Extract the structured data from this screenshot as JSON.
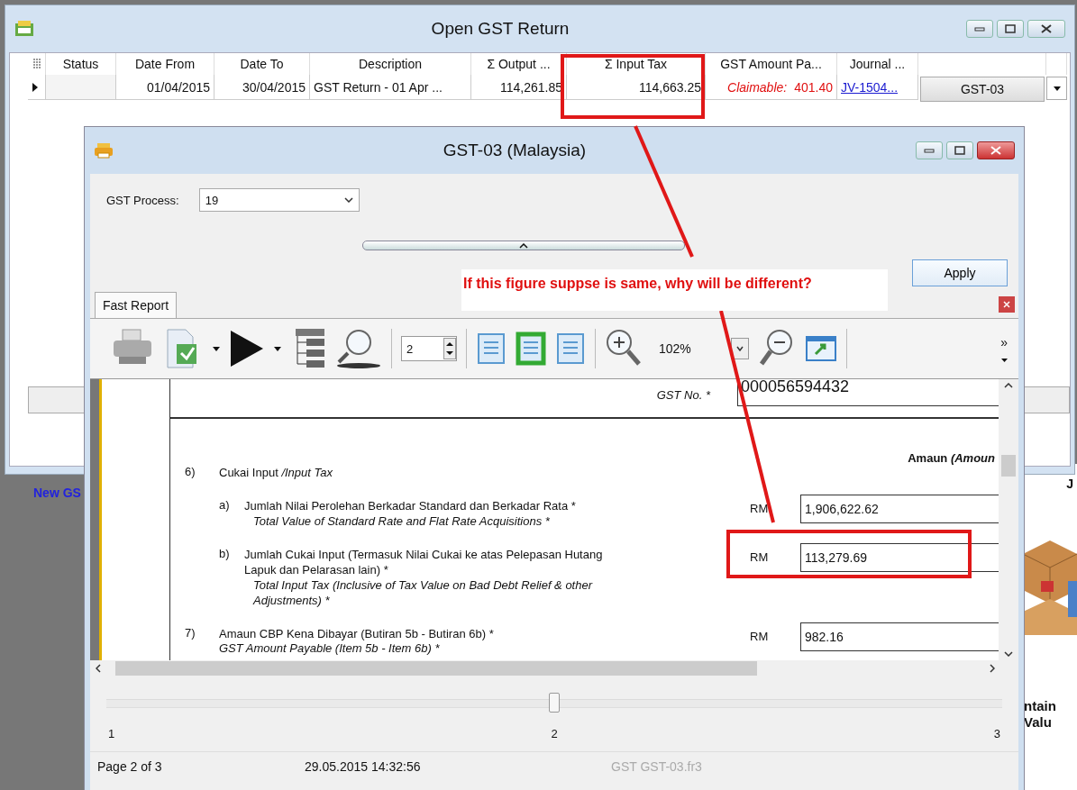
{
  "main_window": {
    "title": "Open GST Return",
    "columns": [
      "Status",
      "Date From",
      "Date To",
      "Description",
      "Σ Output ...",
      "Σ Input Tax",
      "GST Amount Pa...",
      "Journal ..."
    ],
    "rows": [
      {
        "selected": true,
        "status": "",
        "date_from": "01/04/2015",
        "date_to": "30/04/2015",
        "description": "GST Return - 01 Apr ...",
        "output_tax": "114,261.85",
        "input_tax": "114,663.25",
        "amount_label": "Claimable:",
        "amount": "401.40",
        "journal": "JV-1504...",
        "form": "GST-03"
      }
    ],
    "link": "New GS"
  },
  "report_window": {
    "title": "GST-03 (Malaysia)",
    "process_label": "GST Process:",
    "process_value": "19",
    "apply": "Apply",
    "tab": "Fast Report",
    "page_field": "2",
    "zoom_field": "102%",
    "overflow": "»",
    "report": {
      "gst_no_label": "GST No. *",
      "gst_no": "000056594432",
      "amount_heading": "Amaun *(Amoun*",
      "sections": [
        {
          "number": "6)",
          "text": "Cukai Input */Input Tax*",
          "subitems": [
            {
              "letter": "a)",
              "malay": "Jumlah Nilai Perolehan Berkadar Standard dan Berkadar Rata *",
              "english": "Total Value of Standard Rate and Flat Rate Acquisitions *",
              "currency": "RM",
              "value": "1,906,622.62"
            },
            {
              "letter": "b)",
              "malay": "Jumlah Cukai Input (Termasuk Nilai Cukai ke atas Pelepasan Hutang Lapuk dan Pelarasan lain) *",
              "english": "Total Input Tax (Inclusive of Tax Value on Bad Debt Relief & other Adjustments) *",
              "currency": "RM",
              "value": "113,279.69"
            }
          ]
        },
        {
          "number": "7)",
          "text": "Amaun CBP Kena Dibayar (Butiran 5b - Butiran 6b) *",
          "english": "GST Amount Payable (Item 5b - Item 6b) *",
          "currency": "RM",
          "value": "982.16"
        }
      ]
    },
    "page_slider": {
      "level": 0.5,
      "labels": [
        "1",
        "2",
        "3"
      ]
    },
    "status_bar": [
      "Page 2 of 3",
      "29.05.2015 14:32:56",
      "GST GST-03.fr3"
    ]
  },
  "annotation": {
    "note": "If this figure suppse is same, why will be different?"
  },
  "background_app": {
    "corner_text": "J",
    "caption_lines": [
      "ntain",
      "Valu"
    ]
  }
}
